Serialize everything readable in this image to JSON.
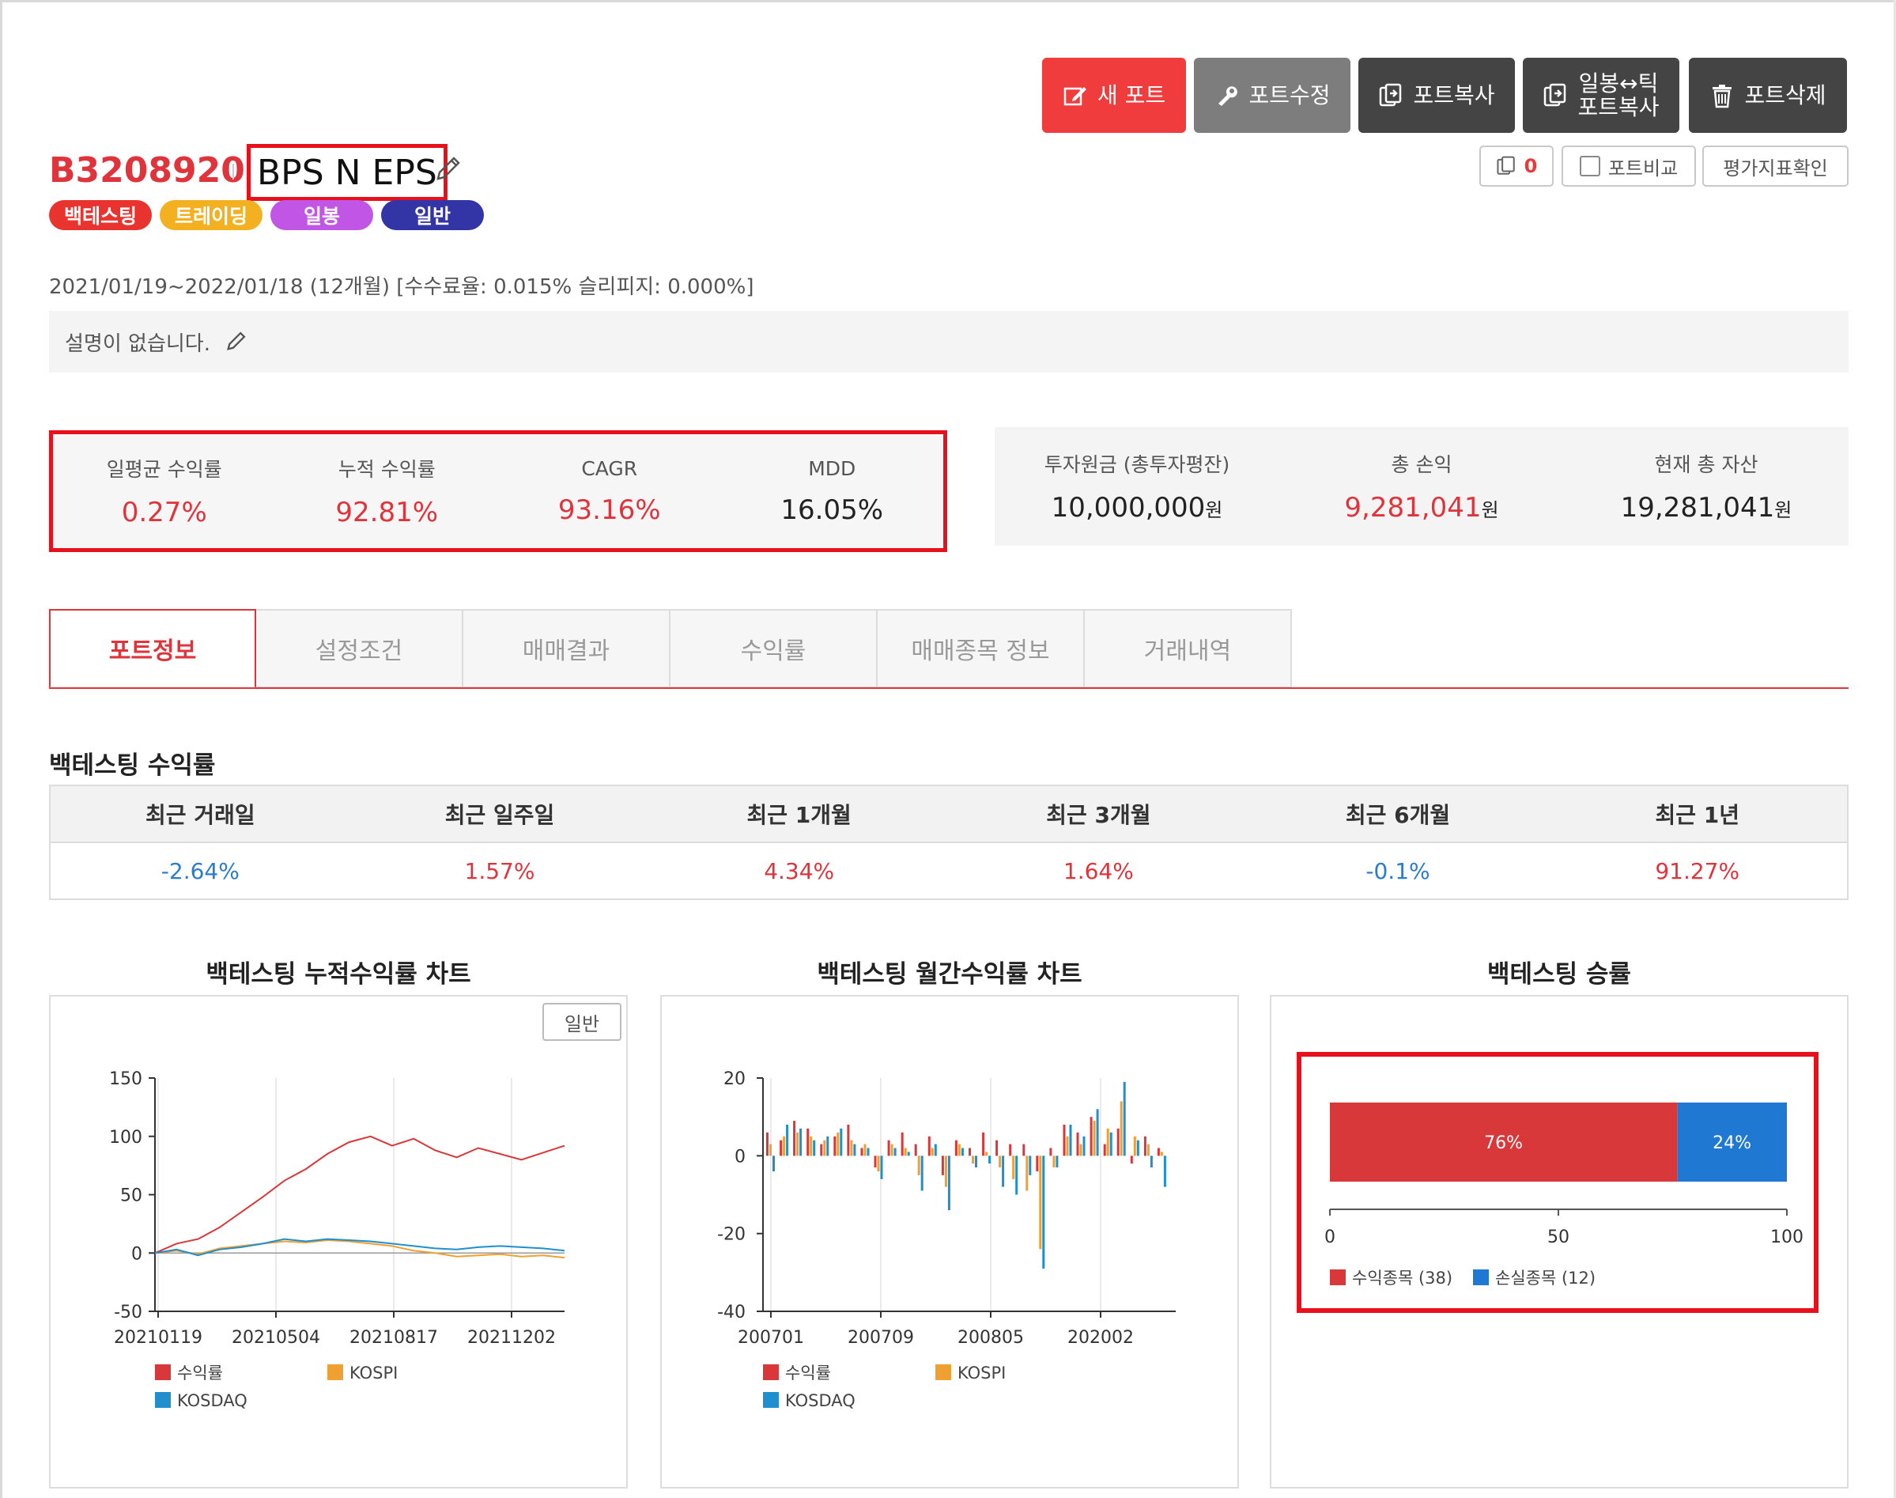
{
  "actions": {
    "new_port": "새 포트",
    "edit_port": "포트수정",
    "copy_port": "포트복사",
    "daytick_line1": "일봉↔틱",
    "daytick_line2": "포트복사",
    "delete_port": "포트삭제"
  },
  "small_actions": {
    "copy_count": "0",
    "compare": "포트비교",
    "metrics": "평가지표확인"
  },
  "portfolio": {
    "code": "B3208920",
    "name": "BPS N EPS",
    "badges": [
      "백테스팅",
      "트레이딩",
      "일봉",
      "일반"
    ],
    "period": "2021/01/19~2022/01/18 (12개월) [수수료율: 0.015% 슬리피지: 0.000%]",
    "description": "설명이 없습니다."
  },
  "stats": [
    {
      "label": "일평균 수익률",
      "value": "0.27%"
    },
    {
      "label": "누적 수익률",
      "value": "92.81%"
    },
    {
      "label": "CAGR",
      "value": "93.16%"
    },
    {
      "label": "MDD",
      "value": "16.05%"
    }
  ],
  "assets": [
    {
      "label": "투자원금 (총투자평잔)",
      "value": "10,000,000",
      "unit": "원"
    },
    {
      "label": "총 손익",
      "value": "9,281,041",
      "unit": "원"
    },
    {
      "label": "현재 총 자산",
      "value": "19,281,041",
      "unit": "원"
    }
  ],
  "tabs": [
    "포트정보",
    "설정조건",
    "매매결과",
    "수익률",
    "매매종목 정보",
    "거래내역"
  ],
  "returns_section": {
    "title": "백테스팅 수익률",
    "headers": [
      "최근 거래일",
      "최근 일주일",
      "최근 1개월",
      "최근 3개월",
      "최근 6개월",
      "최근 1년"
    ],
    "values": [
      "-2.64%",
      "1.57%",
      "4.34%",
      "1.64%",
      "-0.1%",
      "91.27%"
    ]
  },
  "charts": {
    "cumulative_title": "백테스팅 누적수익률 차트",
    "monthly_title": "백테스팅 월간수익률 차트",
    "winrate_title": "백테스팅 승률",
    "mode_button": "일반"
  },
  "colors": {
    "accent_red": "#e0343c",
    "profit": "#d9383a",
    "kospi": "#f0a030",
    "kosdaq": "#1f8fce",
    "loss_blue": "#1f78d1"
  },
  "chart_data": [
    {
      "type": "line",
      "yticks": [
        150,
        100,
        50,
        0,
        -50
      ],
      "ylim": [
        -50,
        150
      ],
      "xticks": [
        "20210119",
        "20210504",
        "20210817",
        "20211202"
      ],
      "series": [
        {
          "name": "수익률",
          "values": [
            0,
            8,
            12,
            22,
            35,
            48,
            62,
            72,
            85,
            95,
            100,
            92,
            98,
            88,
            82,
            90,
            85,
            80,
            86,
            92
          ]
        },
        {
          "name": "KOSPI",
          "values": [
            0,
            2,
            -1,
            4,
            6,
            8,
            10,
            9,
            11,
            10,
            8,
            6,
            2,
            0,
            -3,
            -2,
            -1,
            -3,
            -2,
            -4
          ]
        },
        {
          "name": "KOSDAQ",
          "values": [
            0,
            3,
            -2,
            3,
            5,
            8,
            12,
            10,
            12,
            11,
            10,
            8,
            6,
            4,
            3,
            5,
            6,
            5,
            4,
            2
          ]
        }
      ]
    },
    {
      "type": "bar",
      "yticks": [
        20,
        0,
        -20,
        -40
      ],
      "ylim": [
        -40,
        20
      ],
      "xticks": [
        "200701",
        "200709",
        "200805",
        "202002"
      ],
      "series": [
        {
          "name": "수익률",
          "values": [
            6,
            4,
            9,
            7,
            3,
            5,
            8,
            2,
            -3,
            4,
            6,
            3,
            5,
            -5,
            4,
            2,
            6,
            4,
            3,
            3,
            -4,
            2,
            8,
            6,
            10,
            3,
            7,
            -2,
            5,
            2
          ]
        },
        {
          "name": "KOSPI",
          "values": [
            3,
            5,
            6,
            5,
            4,
            6,
            4,
            3,
            -4,
            3,
            2,
            -5,
            2,
            -8,
            3,
            -2,
            1,
            -3,
            -6,
            -9,
            -24,
            -3,
            5,
            3,
            9,
            7,
            14,
            5,
            3,
            1
          ]
        },
        {
          "name": "KOSDAQ",
          "values": [
            -4,
            8,
            7,
            4,
            5,
            7,
            3,
            2,
            -6,
            2,
            1,
            -9,
            3,
            -14,
            2,
            -3,
            -2,
            -8,
            -10,
            -5,
            -29,
            -3,
            8,
            5,
            12,
            6,
            19,
            4,
            -3,
            -8
          ]
        }
      ]
    },
    {
      "type": "bar",
      "orientation": "horizontal-stacked",
      "xticks": [
        0,
        50,
        100
      ],
      "xlim": [
        0,
        100
      ],
      "segments": [
        {
          "name": "수익종목 (38)",
          "value": 76,
          "label": "76%"
        },
        {
          "name": "손실종목 (12)",
          "value": 24,
          "label": "24%"
        }
      ]
    }
  ]
}
